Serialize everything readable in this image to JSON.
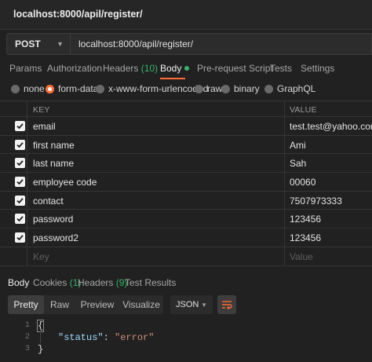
{
  "window": {
    "title": "localhost:8000/apil/register/"
  },
  "request": {
    "method": "POST",
    "url": "localhost:8000/apil/register/"
  },
  "request_tabs": [
    {
      "label": "Params"
    },
    {
      "label": "Authorization"
    },
    {
      "label": "Headers",
      "count": "(10)"
    },
    {
      "label": "Body",
      "active": true
    },
    {
      "label": "Pre-request Script"
    },
    {
      "label": "Tests"
    },
    {
      "label": "Settings"
    }
  ],
  "body_types": [
    {
      "label": "none"
    },
    {
      "label": "form-data",
      "selected": true
    },
    {
      "label": "x-www-form-urlencoded"
    },
    {
      "label": "raw"
    },
    {
      "label": "binary"
    },
    {
      "label": "GraphQL"
    }
  ],
  "table": {
    "headers": {
      "key": "KEY",
      "value": "VALUE"
    },
    "rows": [
      {
        "key": "email",
        "value": "test.test@yahoo.com",
        "checked": true
      },
      {
        "key": "first name",
        "value": "Ami",
        "checked": true
      },
      {
        "key": "last name",
        "value": "Sah",
        "checked": true
      },
      {
        "key": "employee code",
        "value": "00060",
        "checked": true
      },
      {
        "key": "contact",
        "value": "7507973333",
        "checked": true
      },
      {
        "key": "password",
        "value": "123456",
        "checked": true
      },
      {
        "key": "password2",
        "value": "123456",
        "checked": true
      }
    ],
    "placeholder": {
      "key": "Key",
      "value": "Value"
    }
  },
  "response_tabs": [
    {
      "label": "Body",
      "active": true
    },
    {
      "label": "Cookies",
      "count": "(1)"
    },
    {
      "label": "Headers",
      "count": "(9)"
    },
    {
      "label": "Test Results"
    }
  ],
  "response_view": {
    "modes": [
      "Pretty",
      "Raw",
      "Preview",
      "Visualize"
    ],
    "active_mode": "Pretty",
    "format": "JSON"
  },
  "response_body": {
    "line_numbers": [
      "1",
      "2",
      "3"
    ],
    "open_brace": "{",
    "key": "\"status\"",
    "colon": ": ",
    "value": "\"error\"",
    "close_brace": "}"
  },
  "colors": {
    "accent": "#ff6c37",
    "count_green": "#35b56a",
    "background": "#212121"
  }
}
